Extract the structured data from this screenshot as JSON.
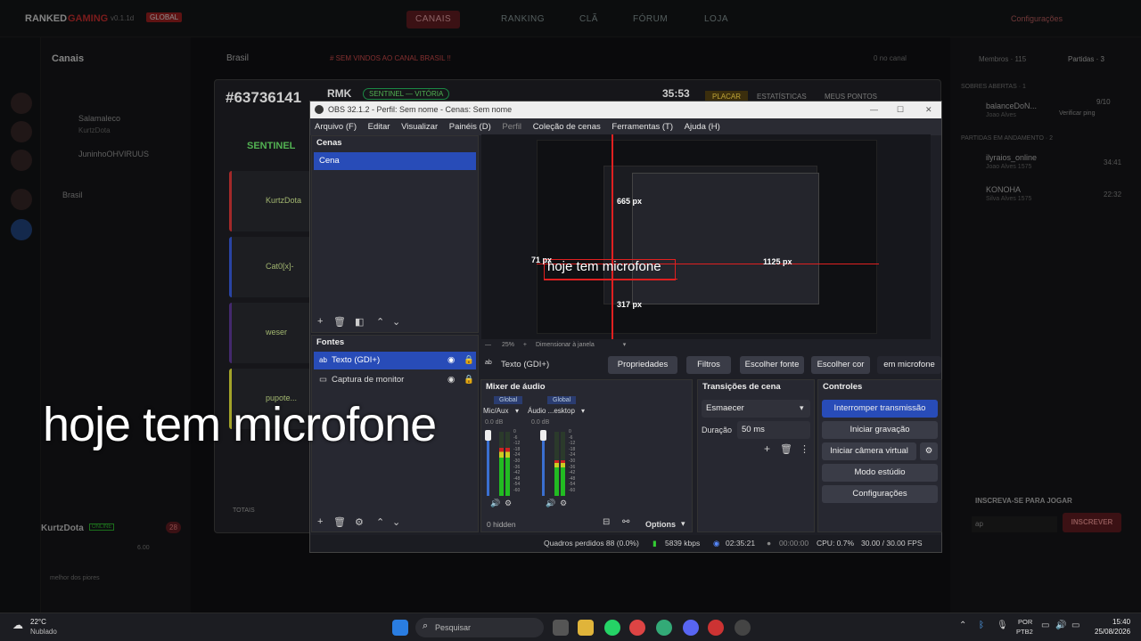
{
  "background_app": {
    "brand": "RANKED",
    "brand2": "GAMING",
    "version": "v0.1.1d",
    "region": "GLOBAL",
    "nav": [
      "CANAIS",
      "RANKING",
      "CLÃ",
      "FÓRUM",
      "LOJA"
    ],
    "settings": "Configurações",
    "channels_title": "Canais",
    "channel_users": [
      "Salamaleco",
      "KurtzDota",
      "JuninhoOHVIRUUS"
    ],
    "channel_group": "Brasil",
    "chat_channel": "Brasil",
    "ticker": "# SEM VINDOS AO CANAL BRASIL !!",
    "chat_status": "0 no canal",
    "members": "Membros · 115",
    "matches": "Partidas · 3",
    "open_matches_title": "SOBRES ABERTAS · 1",
    "match1": {
      "name": "balanceDoN...",
      "count": "9/10",
      "action": "Verificar ping",
      "sub": "Joao Alves"
    },
    "in_progress_title": "PARTIDAS EM ANDAMENTO · 2",
    "match2": {
      "name": "ilyraios_online",
      "time": "34:41",
      "sub": "Joao Alves 1575"
    },
    "match3": {
      "name": "KONOHA",
      "time": "22:32",
      "sub": "Silva Alves 1575"
    },
    "signup_title": "INSCREVA-SE PARA JOGAR",
    "signup_field": "ap",
    "signup_button": "INSCREVER",
    "bottom_user": "KurtzDota",
    "bottom_badge": "ONLINE",
    "bottom_count": "28",
    "bottom_l1": "6.00",
    "bottom_l2": "melhor dos piores"
  },
  "game": {
    "match_id": "#63736141",
    "team": "RMK",
    "status": "SENTINEL — VITÓRIA",
    "timer": "35:53",
    "tabs": [
      "PLACAR",
      "ESTATÍSTICAS",
      "MEUS PONTOS"
    ],
    "side": "SENTINEL",
    "players": [
      "KurtzDota",
      "Cat0[x]-",
      "weser",
      "pupote..."
    ],
    "totals": "TOTAIS"
  },
  "obs": {
    "title": "OBS 32.1.2 - Perfil: Sem nome - Cenas: Sem nome",
    "menu": [
      "Arquivo (F)",
      "Editar",
      "Visualizar",
      "Painéis (D)",
      "Perfil",
      "Coleção de cenas",
      "Ferramentas (T)",
      "Ajuda (H)"
    ],
    "scenes_title": "Cenas",
    "scenes": [
      "Cena"
    ],
    "sources_title": "Fontes",
    "sources": [
      "Texto (GDI+)",
      "Captura de monitor"
    ],
    "zoom": "25%",
    "zoom_mode": "Dimensionar à janela",
    "source_bar": {
      "selected": "Texto (GDI+)",
      "properties": "Propriedades",
      "filters": "Filtros",
      "font": "Escolher fonte",
      "color": "Escolher cor",
      "text": "em microfone"
    },
    "mixer": {
      "title": "Mixer de áudio",
      "channels": [
        {
          "tag": "Global",
          "name": "Mic/Aux",
          "db": "0.0 dB",
          "level": 0.75
        },
        {
          "tag": "Global",
          "name": "Áudio ...esktop",
          "db": "0.0 dB",
          "level": 0.55
        }
      ],
      "scale": [
        "0",
        "-6",
        "-12",
        "-18",
        "-24",
        "-30",
        "-36",
        "-42",
        "-48",
        "-54",
        "-60"
      ],
      "hidden": "0 hidden",
      "options": "Options"
    },
    "transitions": {
      "title": "Transições de cena",
      "type": "Esmaecer",
      "duration_label": "Duração",
      "duration": "50 ms"
    },
    "controls": {
      "title": "Controles",
      "buttons": [
        "Interromper transmissão",
        "Iniciar gravação",
        "Iniciar câmera virtual",
        "Modo estúdio",
        "Configurações"
      ]
    },
    "status": {
      "frames": "Quadros perdidos 88 (0.0%)",
      "kbps": "5839 kbps",
      "stream_time": "02:35:21",
      "rec_time": "00:00:00",
      "cpu": "CPU: 0.7%",
      "fps": "30.00 / 30.00 FPS"
    },
    "preview": {
      "text": "hoje tem microfone",
      "m_top": "665 px",
      "m_left": "71 px",
      "m_right": "1125 px",
      "m_bottom": "317 px"
    }
  },
  "overlay_text": "hoje tem microfone",
  "taskbar": {
    "temp": "22°C",
    "weather": "Nublado",
    "search": "Pesquisar",
    "lang1": "POR",
    "lang2": "PTB2",
    "time": "15:40",
    "date": "25/08/2026"
  }
}
